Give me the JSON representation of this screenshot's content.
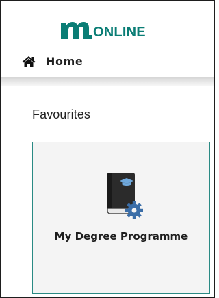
{
  "brand": {
    "name": "ONLINE",
    "logo_icon": "m-logo-icon",
    "color": "#0a7d75"
  },
  "nav": {
    "home_icon": "home-icon",
    "home_label": "Home"
  },
  "favourites": {
    "heading": "Favourites",
    "items": [
      {
        "label": "My Degree Programme",
        "icon": "degree-book-gear-icon"
      }
    ]
  },
  "colors": {
    "accent": "#2a8a84",
    "card_background": "#f4f4f4"
  }
}
